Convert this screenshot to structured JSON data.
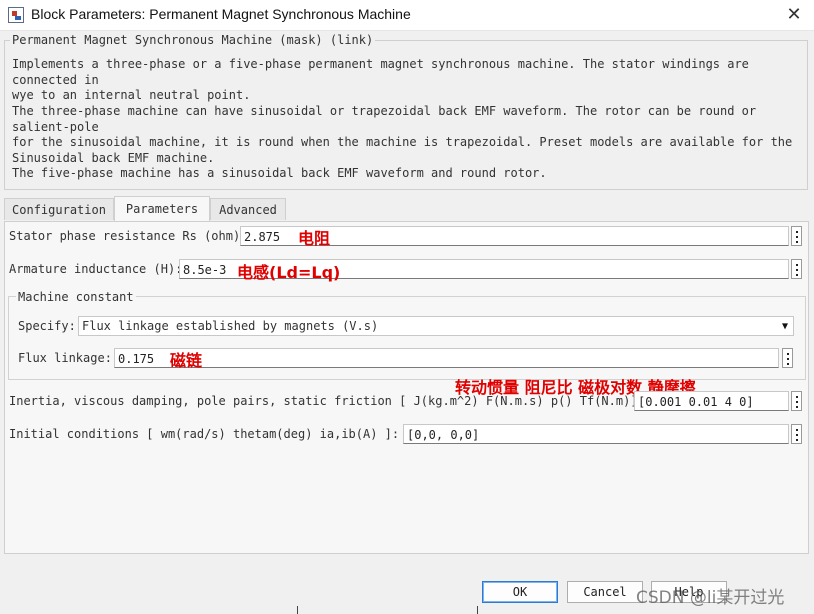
{
  "window": {
    "title": "Block Parameters: Permanent Magnet Synchronous Machine",
    "close_glyph": "✕"
  },
  "mask": {
    "legend": "Permanent Magnet Synchronous Machine (mask) (link)",
    "paragraphs": [
      "Implements a three-phase or a five-phase permanent magnet synchronous machine. The stator windings are connected in\nwye to an internal neutral point.",
      "The three-phase machine can have sinusoidal or trapezoidal back EMF waveform. The rotor can be round or salient-pole\nfor the sinusoidal machine, it is round when the machine is trapezoidal. Preset models are available for the\nSinusoidal back EMF machine.",
      "The five-phase machine has a sinusoidal back EMF waveform and round rotor."
    ]
  },
  "tabs": [
    {
      "label": "Configuration",
      "active": false
    },
    {
      "label": "Parameters",
      "active": true
    },
    {
      "label": "Advanced",
      "active": false
    }
  ],
  "params": {
    "stator_resistance": {
      "label": "Stator phase resistance Rs (ohm):",
      "value": "2.875",
      "annotation": "电阻"
    },
    "armature_inductance": {
      "label": "Armature inductance (H):",
      "value": "8.5e-3",
      "annotation": "电感(Ld=Lq)"
    },
    "machine_constant": {
      "legend": "Machine constant",
      "specify_label": "Specify:",
      "specify_value": "Flux linkage established by magnets (V.s)",
      "flux_label": "Flux linkage:",
      "flux_value": "0.175",
      "flux_annotation": "磁链"
    },
    "inertia": {
      "label": "Inertia, viscous damping, pole pairs, static friction [ J(kg.m^2)  F(N.m.s)  p()  Tf(N.m)]:",
      "value": "[0.001 0.01 4 0]",
      "annotation": "转动惯量  阻尼比  磁极对数  静摩擦"
    },
    "initial_conditions": {
      "label": "Initial conditions  [ wm(rad/s)  thetam(deg)  ia,ib(A) ]:",
      "value": "[0,0, 0,0]"
    }
  },
  "buttons": {
    "ok": "OK",
    "cancel": "Cancel",
    "help": "Help"
  },
  "watermark": "CSDN @li某开过光",
  "icons": {
    "more": "ellipsis-vertical-icon",
    "dropdown": "chevron-down-icon"
  }
}
